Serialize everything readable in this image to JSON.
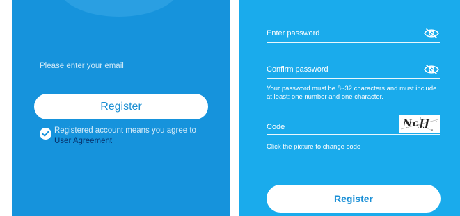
{
  "left_screen": {
    "email_placeholder": "Please enter your email",
    "register_label": "Register",
    "agreement_text": "Registered account means you agree to",
    "agreement_link": "User Agreement",
    "agreement_checked": true
  },
  "right_screen": {
    "password_label": "Enter password",
    "confirm_label": "Confirm password",
    "password_hint": "Your password must be 8~32 characters and must include at least: one number and one character.",
    "code_label": "Code",
    "captcha_text": "NcJJ",
    "change_code_hint": "Click the picture to change code",
    "register_label": "Register"
  },
  "icons": {
    "eye": "eye-slash-icon",
    "check": "checkmark-circle-icon"
  },
  "colors": {
    "left_background": "#1693dc",
    "right_background": "#1aabec",
    "button_background": "#ffffff",
    "link_color": "#07336d"
  }
}
